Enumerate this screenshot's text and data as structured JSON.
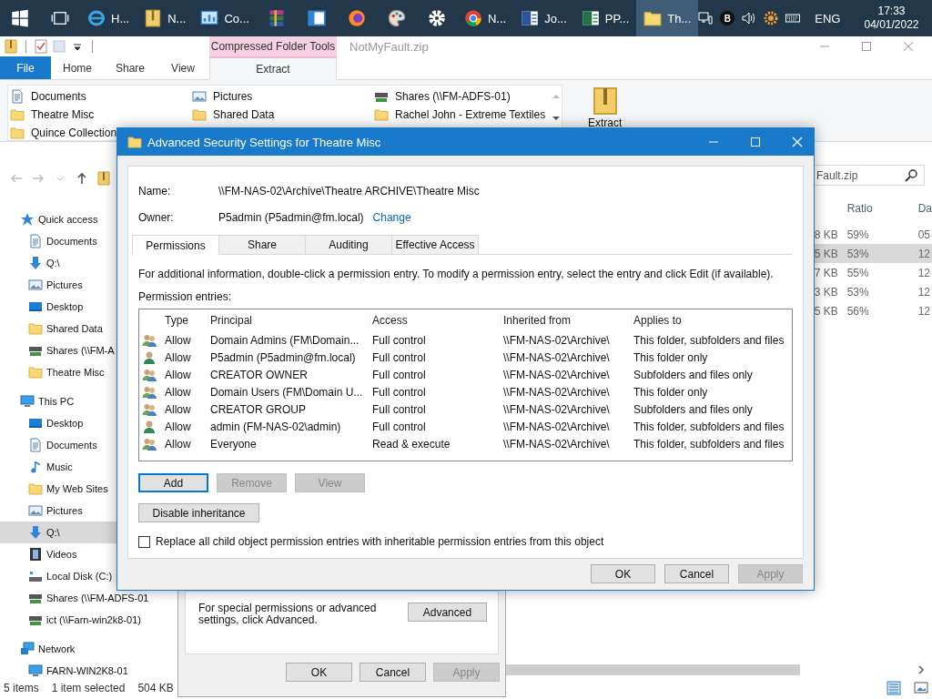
{
  "taskbar": {
    "items": [
      {
        "kind": "start",
        "active": false
      },
      {
        "kind": "task-view",
        "active": false
      },
      {
        "kind": "browser-e",
        "label": "H...",
        "active": false
      },
      {
        "kind": "zip-folder",
        "label": "N...",
        "active": false
      },
      {
        "kind": "control-panel",
        "label": "Co...",
        "active": false
      },
      {
        "kind": "archive",
        "active": false
      },
      {
        "kind": "window",
        "active": false
      },
      {
        "kind": "fox",
        "active": false
      },
      {
        "kind": "palette",
        "active": false
      },
      {
        "kind": "gear",
        "active": false
      },
      {
        "kind": "chrome",
        "label": "N...",
        "active": false
      },
      {
        "kind": "word",
        "label": "Jo...",
        "active": false
      },
      {
        "kind": "excel",
        "label": "PP...",
        "active": false
      },
      {
        "kind": "folder",
        "label": "Th...",
        "active": true
      }
    ],
    "tray": [
      {
        "kind": "tray-network"
      },
      {
        "kind": "badge",
        "label": "B"
      },
      {
        "kind": "volume"
      },
      {
        "kind": "sun"
      },
      {
        "kind": "keyboard"
      }
    ],
    "language": "ENG",
    "time": "17:33",
    "date": "04/01/2022"
  },
  "explorer": {
    "context_group": "Compressed Folder Tools",
    "title": "NotMyFault.zip",
    "ribbon_tabs": [
      {
        "label": "File",
        "kind": "file",
        "selected": false
      },
      {
        "label": "Home",
        "kind": "tab",
        "selected": false
      },
      {
        "label": "Share",
        "kind": "tab",
        "selected": false
      },
      {
        "label": "View",
        "kind": "tab",
        "selected": false
      },
      {
        "label": "Extract",
        "kind": "context",
        "selected": true
      }
    ],
    "extract_to": [
      {
        "kind": "document",
        "label": "Documents"
      },
      {
        "kind": "picture",
        "label": "Pictures"
      },
      {
        "kind": "share",
        "label": "Shares (\\\\FM-ADFS-01)"
      },
      {
        "kind": "folder",
        "label": "Theatre Misc"
      },
      {
        "kind": "folder",
        "label": "Shared Data"
      },
      {
        "kind": "folder",
        "label": "Rachel John - Extreme Textiles"
      },
      {
        "kind": "folder",
        "label": "Quince Collection"
      }
    ],
    "extract_button": "Extract",
    "search": {
      "value": "Fault.zip"
    },
    "nav": [
      {
        "label": "Quick access",
        "kind": "star",
        "selected": false,
        "children": [
          {
            "label": "Documents",
            "kind": "document",
            "selected": false
          },
          {
            "label": "Q:\\",
            "kind": "download",
            "selected": false
          },
          {
            "label": "Pictures",
            "kind": "picture",
            "selected": false
          },
          {
            "label": "Desktop",
            "kind": "desktop",
            "selected": false
          },
          {
            "label": "Shared Data",
            "kind": "folder",
            "selected": false
          },
          {
            "label": "Shares (\\\\FM-A",
            "kind": "share",
            "selected": false
          },
          {
            "label": "Theatre Misc",
            "kind": "folder",
            "selected": false
          }
        ]
      },
      {
        "label": "This PC",
        "kind": "pc",
        "selected": false,
        "children": [
          {
            "label": "Desktop",
            "kind": "desktop",
            "selected": false
          },
          {
            "label": "Documents",
            "kind": "document",
            "selected": false
          },
          {
            "label": "Music",
            "kind": "music",
            "selected": false
          },
          {
            "label": "My Web Sites",
            "kind": "folder",
            "selected": false
          },
          {
            "label": "Pictures",
            "kind": "picture",
            "selected": false
          },
          {
            "label": "Q:\\",
            "kind": "download",
            "selected": true
          },
          {
            "label": "Videos",
            "kind": "video",
            "selected": false
          },
          {
            "label": "Local Disk (C:)",
            "kind": "disk",
            "selected": false
          },
          {
            "label": "Shares (\\\\FM-ADFS-01",
            "kind": "share",
            "selected": false
          },
          {
            "label": "ict (\\\\Farn-win2k8-01)",
            "kind": "share",
            "selected": false
          }
        ]
      },
      {
        "label": "Network",
        "kind": "network",
        "selected": false,
        "children": [
          {
            "label": "FARN-WIN2K8-01",
            "kind": "pc",
            "selected": false
          }
        ]
      }
    ],
    "file_list": {
      "headings": [
        "Ratio",
        "Da"
      ],
      "rows": [
        {
          "cells": [
            "8 KB",
            "59%",
            "05"
          ],
          "selected": false
        },
        {
          "cells": [
            "5 KB",
            "53%",
            "12"
          ],
          "selected": true
        },
        {
          "cells": [
            "7 KB",
            "55%",
            "12"
          ],
          "selected": false
        },
        {
          "cells": [
            "3 KB",
            "53%",
            "12"
          ],
          "selected": false
        },
        {
          "cells": [
            "5 KB",
            "56%",
            "12"
          ],
          "selected": false
        }
      ]
    },
    "status": {
      "count": "5 items",
      "selection": "1 item selected",
      "size": "504 KB"
    }
  },
  "properties_dialog": {
    "note": "For special permissions or advanced settings, click Advanced.",
    "advanced_button": "Advanced",
    "buttons": [
      {
        "label": "OK",
        "disabled": false
      },
      {
        "label": "Cancel",
        "disabled": false
      },
      {
        "label": "Apply",
        "disabled": true
      }
    ]
  },
  "security_dialog": {
    "title": "Advanced Security Settings for Theatre Misc",
    "name_label": "Name:",
    "name": "\\\\FM-NAS-02\\Archive\\Theatre ARCHIVE\\Theatre Misc",
    "owner_label": "Owner:",
    "owner": "P5admin (P5admin@fm.local)",
    "owner_link": "Change",
    "tabs": [
      {
        "label": "Permissions",
        "selected": true
      },
      {
        "label": "Share",
        "selected": false
      },
      {
        "label": "Auditing",
        "selected": false
      },
      {
        "label": "Effective Access",
        "selected": false
      }
    ],
    "info": "For additional information, double-click a permission entry. To modify a permission entry, select the entry and click Edit (if available).",
    "entries_label": "Permission entries:",
    "columns": [
      "Type",
      "Principal",
      "Access",
      "Inherited from",
      "Applies to"
    ],
    "entries": [
      {
        "kind": "group",
        "type": "Allow",
        "principal": "Domain Admins (FM\\Domain...",
        "access": "Full control",
        "inherited_from": "\\\\FM-NAS-02\\Archive\\",
        "applies_to": "This folder, subfolders and files"
      },
      {
        "kind": "user",
        "type": "Allow",
        "principal": "P5admin (P5admin@fm.local)",
        "access": "Full control",
        "inherited_from": "\\\\FM-NAS-02\\Archive\\",
        "applies_to": "This folder only"
      },
      {
        "kind": "group",
        "type": "Allow",
        "principal": "CREATOR OWNER",
        "access": "Full control",
        "inherited_from": "\\\\FM-NAS-02\\Archive\\",
        "applies_to": "Subfolders and files only"
      },
      {
        "kind": "group",
        "type": "Allow",
        "principal": "Domain Users (FM\\Domain U...",
        "access": "Full control",
        "inherited_from": "\\\\FM-NAS-02\\Archive\\",
        "applies_to": "This folder only"
      },
      {
        "kind": "group",
        "type": "Allow",
        "principal": "CREATOR GROUP",
        "access": "Full control",
        "inherited_from": "\\\\FM-NAS-02\\Archive\\",
        "applies_to": "Subfolders and files only"
      },
      {
        "kind": "user",
        "type": "Allow",
        "principal": "admin (FM-NAS-02\\admin)",
        "access": "Full control",
        "inherited_from": "\\\\FM-NAS-02\\Archive\\",
        "applies_to": "This folder, subfolders and files"
      },
      {
        "kind": "group",
        "type": "Allow",
        "principal": "Everyone",
        "access": "Read & execute",
        "inherited_from": "\\\\FM-NAS-02\\Archive\\",
        "applies_to": "This folder, subfolders and files"
      }
    ],
    "entry_buttons": [
      {
        "label": "Add",
        "disabled": false,
        "default": true
      },
      {
        "label": "Remove",
        "disabled": true,
        "default": false
      },
      {
        "label": "View",
        "disabled": true,
        "default": false
      }
    ],
    "inheritance_button": "Disable inheritance",
    "replace_checkbox": {
      "label": "Replace all child object permission entries with inheritable permission entries from this object",
      "checked": false
    },
    "buttons": [
      {
        "label": "OK",
        "disabled": false
      },
      {
        "label": "Cancel",
        "disabled": false
      },
      {
        "label": "Apply",
        "disabled": true
      }
    ]
  }
}
